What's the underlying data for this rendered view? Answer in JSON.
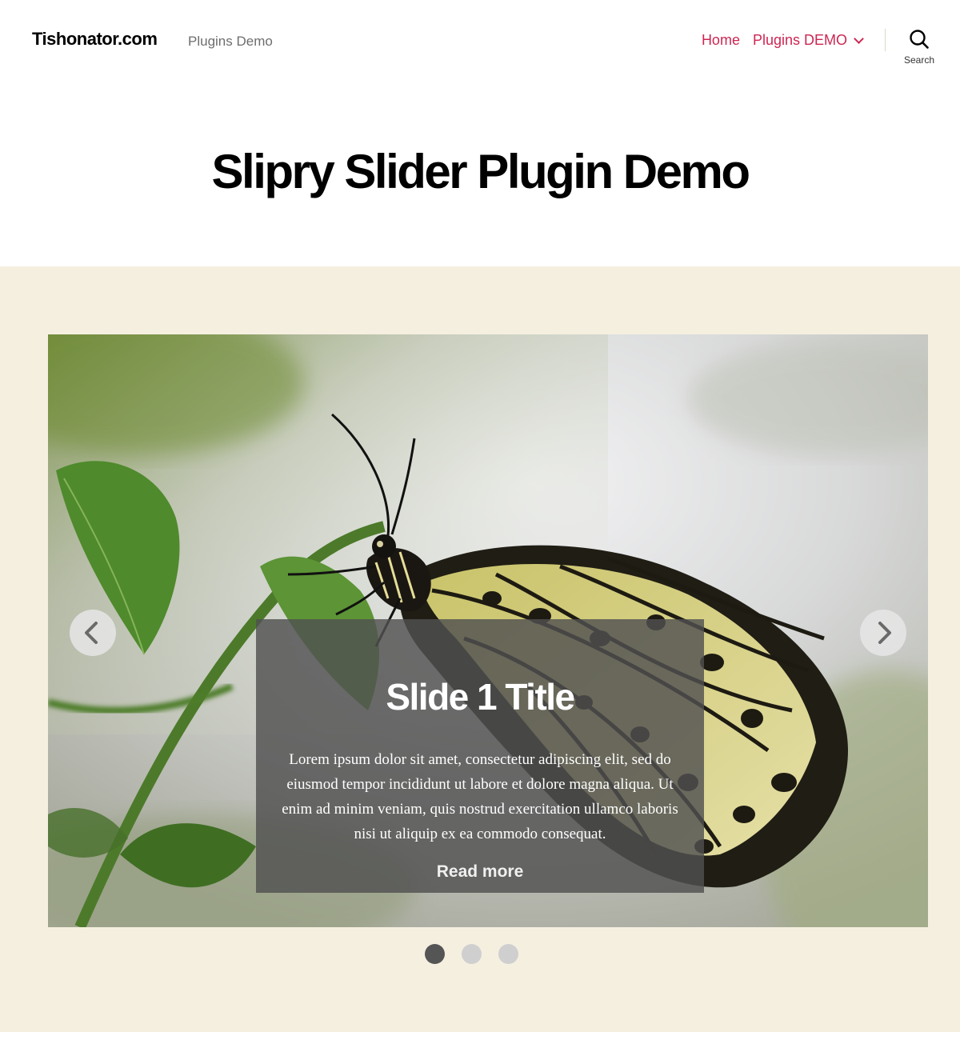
{
  "header": {
    "site_title": "Tishonator.com",
    "site_description": "Plugins Demo",
    "nav": [
      {
        "label": "Home"
      },
      {
        "label": "Plugins DEMO",
        "has_submenu": true
      }
    ],
    "search_label": "Search"
  },
  "page": {
    "title": "Slipry Slider Plugin Demo"
  },
  "slider": {
    "current_slide": 1,
    "slide_count": 3,
    "slide": {
      "title": "Slide 1 Title",
      "text": "Lorem ipsum dolor sit amet, consectetur adipiscing elit, sed do eiusmod tempor incididunt ut labore et dolore magna aliqua. Ut enim ad minim veniam, quis nostrud exercitation ullamco laboris nisi ut aliquip ex ea commodo consequat.",
      "read_more": "Read more"
    },
    "arrows": {
      "prev_icon": "chevron-left-icon",
      "next_icon": "chevron-right-icon"
    }
  },
  "colors": {
    "accent": "#cd2653",
    "band_background": "#f5efe0",
    "dot_active": "#555555",
    "dot_inactive": "#cfcfcf"
  }
}
